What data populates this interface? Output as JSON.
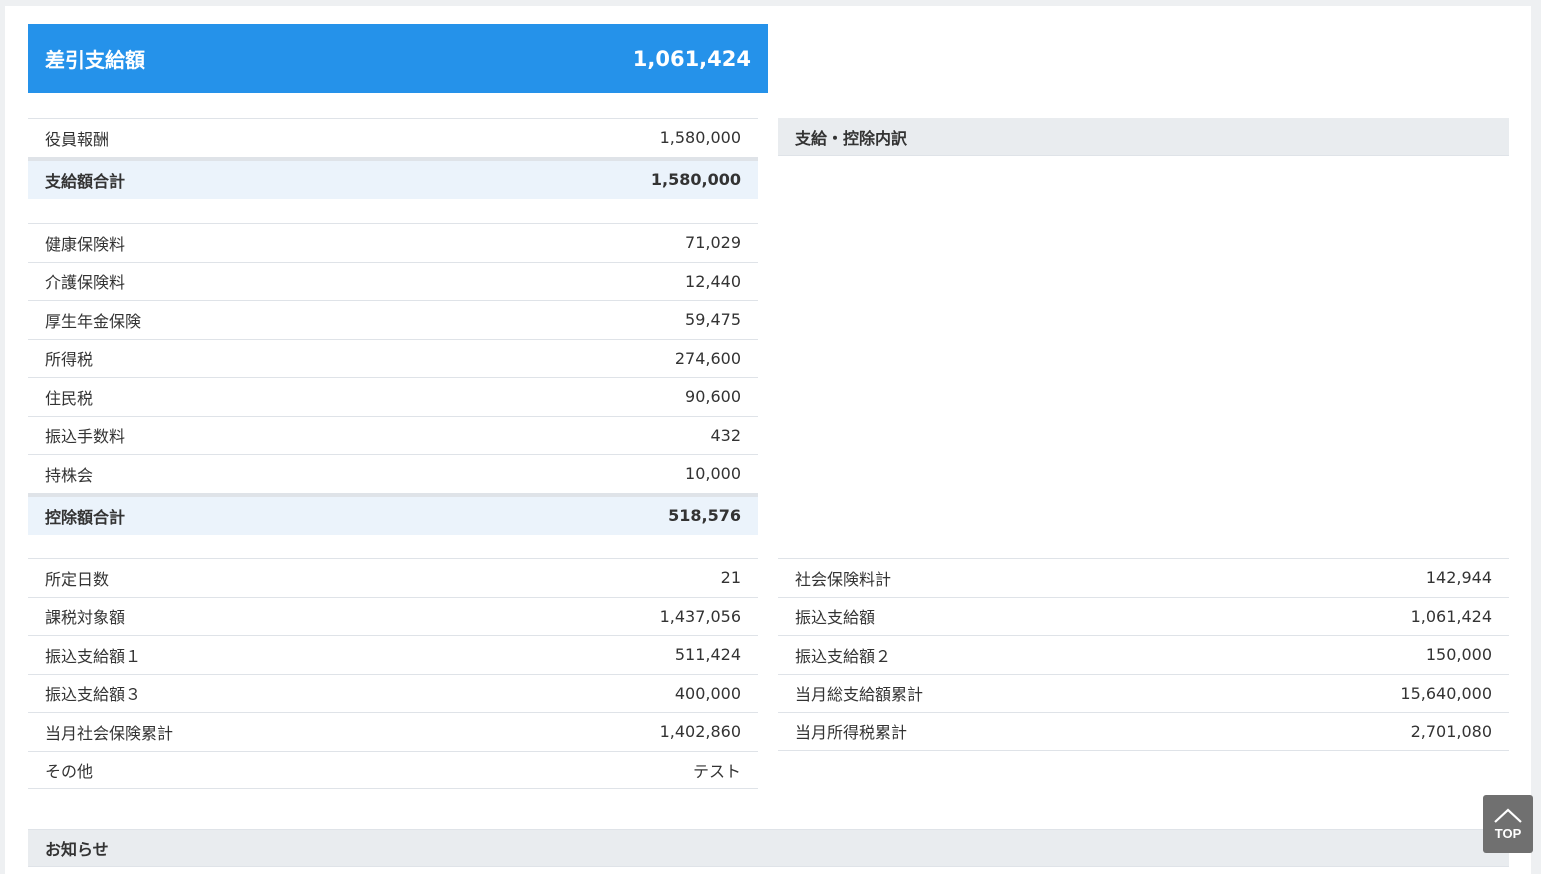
{
  "net_pay": {
    "label": "差引支給額",
    "value": "1,061,424"
  },
  "payments": {
    "items": [
      {
        "label": "役員報酬",
        "value": "1,580,000"
      }
    ],
    "total": {
      "label": "支給額合計",
      "value": "1,580,000"
    }
  },
  "deductions": {
    "items": [
      {
        "label": "健康保険料",
        "value": "71,029"
      },
      {
        "label": "介護保険料",
        "value": "12,440"
      },
      {
        "label": "厚生年金保険",
        "value": "59,475"
      },
      {
        "label": "所得税",
        "value": "274,600"
      },
      {
        "label": "住民税",
        "value": "90,600"
      },
      {
        "label": "振込手数料",
        "value": "432"
      },
      {
        "label": "持株会",
        "value": "10,000"
      }
    ],
    "total": {
      "label": "控除額合計",
      "value": "518,576"
    }
  },
  "breakdown": {
    "title": "支給・控除内訳"
  },
  "other_left": [
    {
      "label": "所定日数",
      "value": "21"
    },
    {
      "label": "課税対象額",
      "value": "1,437,056"
    },
    {
      "label": "振込支給額１",
      "value": "511,424"
    },
    {
      "label": "振込支給額３",
      "value": "400,000"
    },
    {
      "label": "当月社会保険累計",
      "value": "1,402,860"
    },
    {
      "label": "その他",
      "value": "テスト"
    }
  ],
  "other_right": [
    {
      "label": "社会保険料計",
      "value": "142,944"
    },
    {
      "label": "振込支給額",
      "value": "1,061,424"
    },
    {
      "label": "振込支給額２",
      "value": "150,000"
    },
    {
      "label": "当月総支給額累計",
      "value": "15,640,000"
    },
    {
      "label": "当月所得税累計",
      "value": "2,701,080"
    }
  ],
  "notice": {
    "title": "お知らせ"
  },
  "top_button": {
    "label": "TOP",
    "icon": "chevron-up-icon"
  }
}
